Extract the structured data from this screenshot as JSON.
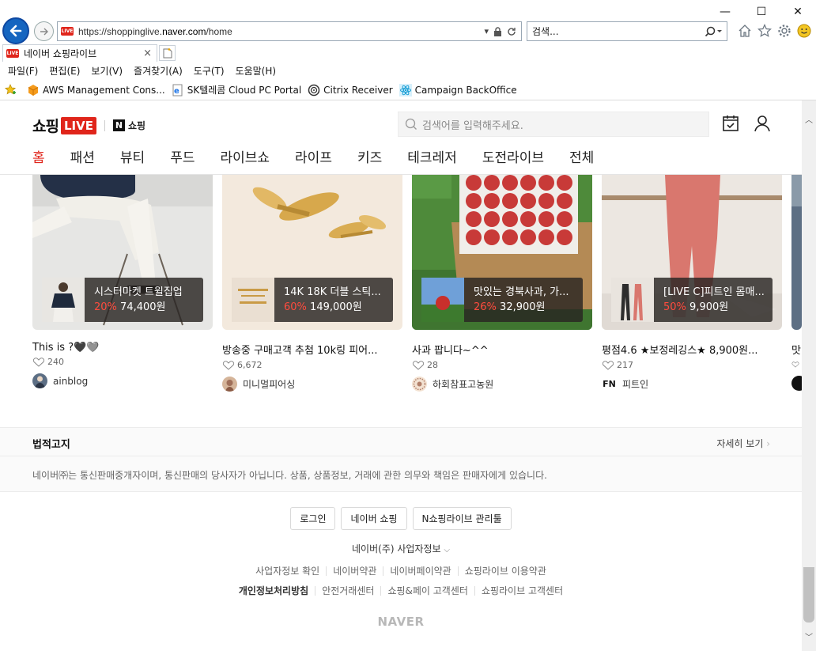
{
  "browser": {
    "url_prefix": "https://shoppinglive.",
    "url_domain": "naver.com",
    "url_path": "/home",
    "search_placeholder": "검색...",
    "tab_title": "네이버 쇼핑라이브",
    "tab_close": "×",
    "favicon_text": "LIVE",
    "menu": [
      "파일(F)",
      "편집(E)",
      "보기(V)",
      "즐겨찾기(A)",
      "도구(T)",
      "도움말(H)"
    ],
    "favorites": [
      "AWS Management Cons...",
      "SK텔레콤 Cloud PC Portal",
      "Citrix Receiver",
      "Campaign BackOffice"
    ],
    "window": {
      "minimize": "—",
      "maximize": "☐",
      "close": "✕"
    }
  },
  "site": {
    "logo_text": "쇼핑",
    "logo_badge": "LIVE",
    "logo_n": "N",
    "logo_shop": "쇼핑",
    "search_placeholder": "검색어를 입력해주세요.",
    "categories": [
      "홈",
      "패션",
      "뷰티",
      "푸드",
      "라이브쇼",
      "라이프",
      "키즈",
      "테크레저",
      "도전라이브",
      "전체"
    ],
    "active_category": "홈"
  },
  "cards": [
    {
      "name": "시스터마켓 트윌집업",
      "pct": "20%",
      "price": "74,400원",
      "title": "This is ?🖤🩶",
      "likes": "240",
      "seller": "ainblog"
    },
    {
      "name": "14K 18K 더블 스틱...",
      "pct": "60%",
      "price": "149,000원",
      "title": "방송중 구매고객 추첨 10k링 피어...",
      "likes": "6,672",
      "seller": "미니멀피어싱"
    },
    {
      "name": "맛있는 경북사과, 가...",
      "pct": "26%",
      "price": "32,900원",
      "title": "사과 팝니다~^^",
      "likes": "28",
      "seller": "하회참표고농원"
    },
    {
      "name": "[LIVE C]피트인 몸매...",
      "pct": "50%",
      "price": "9,900원",
      "title": "평점4.6 ★보정레깅스★ 8,900원...",
      "likes": "217",
      "seller": "피트인",
      "seller_logo": "FN"
    },
    {
      "title": "맛"
    }
  ],
  "legal": {
    "title": "법적고지",
    "more": "자세히 보기",
    "body": "네이버㈜는 통신판매중개자이며, 통신판매의 당사자가 아닙니다. 상품, 상품정보, 거래에 관한 의무와 책임은 판매자에게 있습니다."
  },
  "footer": {
    "buttons": [
      "로그인",
      "네이버 쇼핑",
      "N쇼핑라이브 관리툴"
    ],
    "biz": "네이버(주) 사업자정보",
    "links1": [
      "사업자정보 확인",
      "네이버약관",
      "네이버페이약관",
      "쇼핑라이브 이용약관"
    ],
    "links2": [
      "개인정보처리방침",
      "안전거래센터",
      "쇼핑&페이 고객센터",
      "쇼핑라이브 고객센터"
    ],
    "naver": "NAVER"
  },
  "colors": {
    "accent": "#e0251b",
    "ie_blue": "#1565c0"
  }
}
